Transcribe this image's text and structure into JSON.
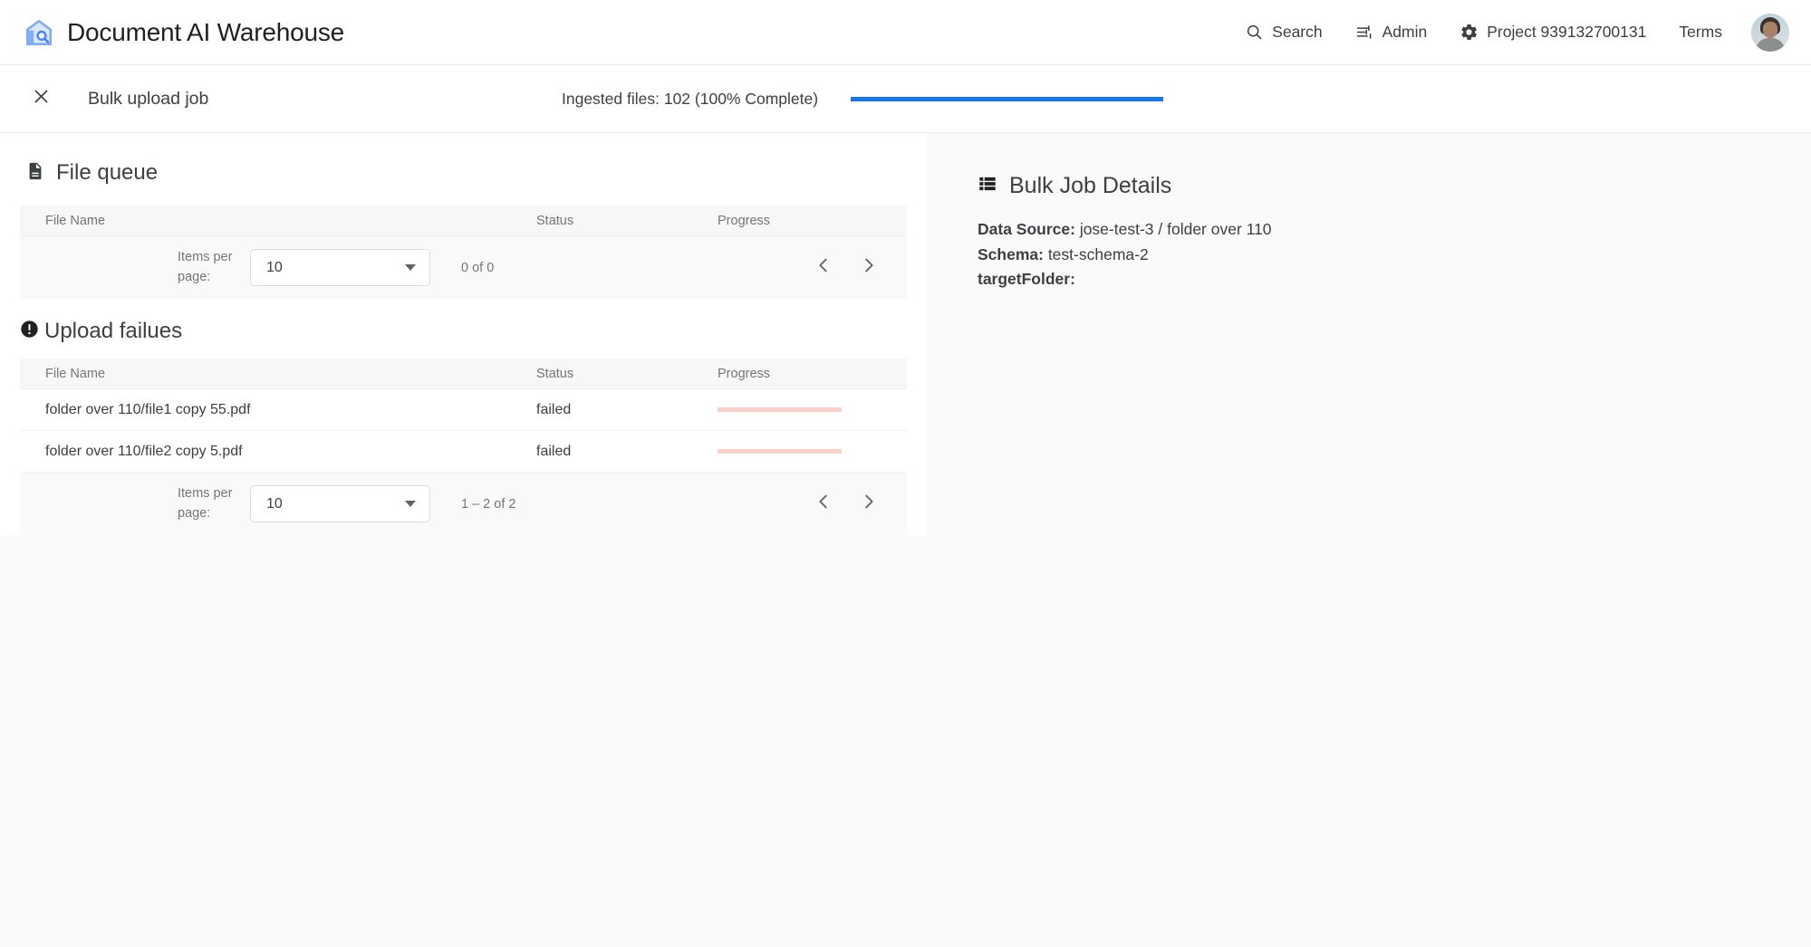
{
  "appbar": {
    "logo_icon": "warehouse-search-logo",
    "title": "Document AI Warehouse",
    "nav": [
      {
        "icon": "search-icon",
        "label": "Search"
      },
      {
        "icon": "tune-icon",
        "label": "Admin"
      },
      {
        "icon": "gear-icon",
        "label": "Project 939132700131"
      },
      {
        "icon": "",
        "label": "Terms"
      }
    ],
    "avatar_name": "user-avatar"
  },
  "jobbar": {
    "close_icon": "close-icon",
    "title": "Bulk upload job",
    "ingested_text": "Ingested files: 102 (100% Complete)",
    "progress_percent": 100,
    "progress_color": "#1a73e8"
  },
  "file_queue": {
    "icon": "document-icon",
    "title": "File queue",
    "columns": [
      "File Name",
      "Status",
      "Progress"
    ],
    "rows": [],
    "paginator": {
      "items_per_page_label": "Items per page:",
      "page_size": "10",
      "range_label": "0 of 0",
      "prev_icon": "chevron-left-icon",
      "next_icon": "chevron-right-icon"
    }
  },
  "upload_failures": {
    "icon": "error-icon",
    "title": "Upload failues",
    "columns": [
      "File Name",
      "Status",
      "Progress"
    ],
    "rows": [
      {
        "name": "folder over 110/file1 copy 55.pdf",
        "status": "failed",
        "progress_color": "#fbd0c8"
      },
      {
        "name": "folder over 110/file2 copy 5.pdf",
        "status": "failed",
        "progress_color": "#fbd0c8"
      }
    ],
    "paginator": {
      "items_per_page_label": "Items per page:",
      "page_size": "10",
      "range_label": "1 – 2 of 2",
      "prev_icon": "chevron-left-icon",
      "next_icon": "chevron-right-icon"
    }
  },
  "bulk_job_details": {
    "icon": "list-icon",
    "title": "Bulk Job Details",
    "fields": [
      {
        "label": "Data Source:",
        "value": "jose-test-3 / folder over 110"
      },
      {
        "label": "Schema:",
        "value": "test-schema-2"
      },
      {
        "label": "targetFolder:",
        "value": ""
      }
    ]
  }
}
